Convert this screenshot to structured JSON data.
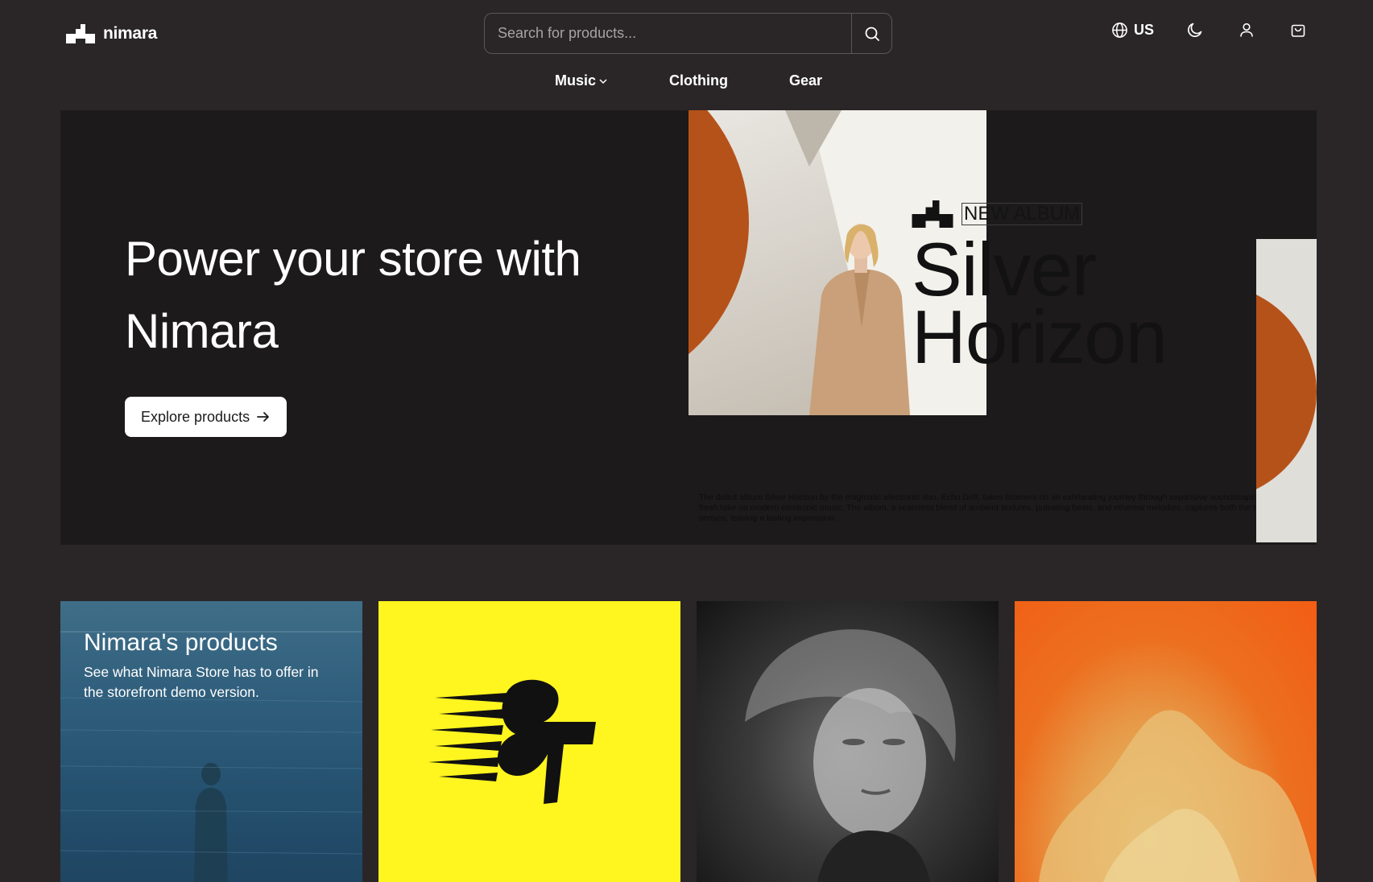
{
  "brand": {
    "name": "nimara"
  },
  "search": {
    "placeholder": "Search for products..."
  },
  "header": {
    "locale": "US"
  },
  "nav": {
    "items": [
      {
        "label": "Music"
      },
      {
        "label": "Clothing"
      },
      {
        "label": "Gear"
      }
    ]
  },
  "hero": {
    "title": "Power your store with Nimara",
    "cta": "Explore products",
    "album": {
      "tag": "NEW ALBUM",
      "name": "Silver Horizon",
      "description": "The debut album Silver Horizon by the enigmatic electronic duo, Echo Drift, takes listeners on an exhilarating journey through expansive soundscapes, offering a fresh take on modern electronic music. The album, a seamless blend of ambient textures, pulsating beats, and ethereal melodies, captures both the mind and the senses, leaving a lasting impression."
    }
  },
  "tiles": [
    {
      "title": "Nimara's products",
      "subtitle": "See what Nimara Store has to offer in the storefront demo version."
    }
  ],
  "colors": {
    "background": "#2a2627",
    "hero_background": "#1c1a1a",
    "accent_orange": "#b5521a",
    "tile_yellow": "#fff51f",
    "tile_orange": "#f25d14"
  },
  "icons": [
    "logo-mark-icon",
    "search-icon",
    "globe-icon",
    "moon-icon",
    "user-icon",
    "cart-icon",
    "chevron-down-icon",
    "arrow-right-icon"
  ]
}
